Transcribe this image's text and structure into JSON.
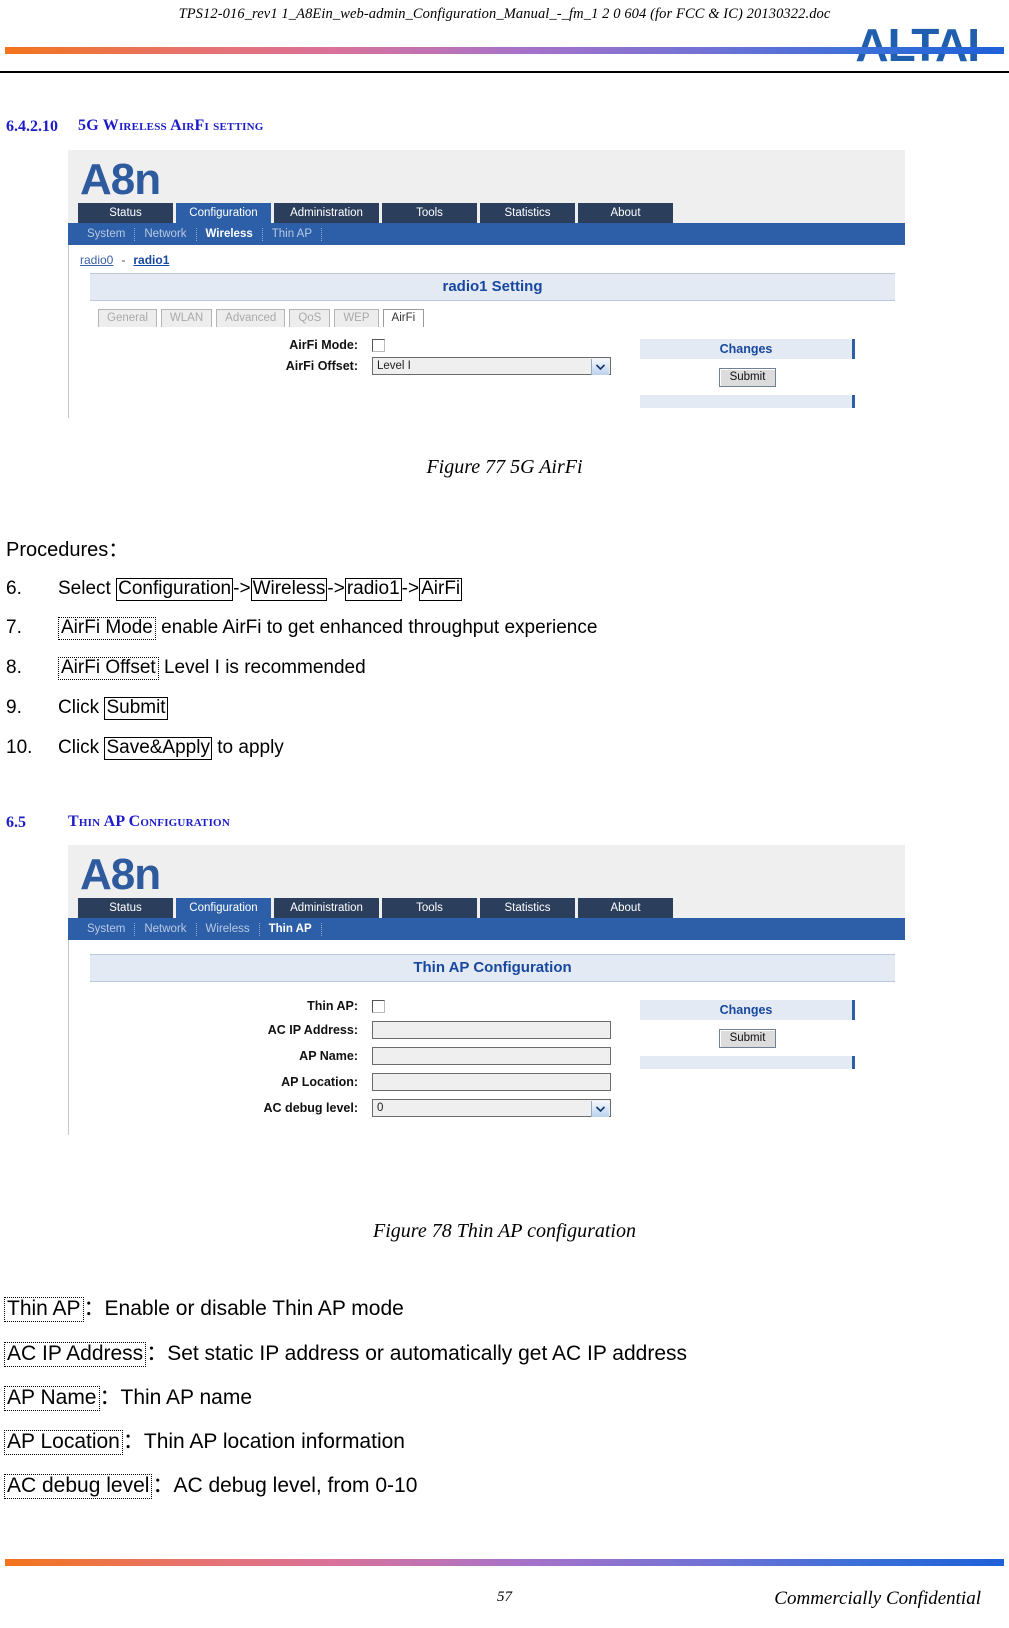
{
  "header": {
    "doc_title": "TPS12-016_rev1 1_A8Ein_web-admin_Configuration_Manual_-_fm_1 2 0 604 (for FCC & IC) 20130322.doc",
    "logo_text": "ALTAI",
    "gradient_colors": [
      "#F2741B",
      "#D9729B",
      "#7272D4",
      "#1F5FD8"
    ]
  },
  "sections": {
    "s1": {
      "number": "6.4.2.10",
      "title": "5G Wireless AirFi setting"
    },
    "s2": {
      "number": "6.5",
      "title": "Thin AP Configuration"
    }
  },
  "screenshot1": {
    "product_logo": "A8n",
    "nav_tabs": [
      {
        "label": "Status",
        "active": false
      },
      {
        "label": "Configuration",
        "active": true
      },
      {
        "label": "Administration",
        "active": false
      },
      {
        "label": "Tools",
        "active": false
      },
      {
        "label": "Statistics",
        "active": false
      },
      {
        "label": "About",
        "active": false
      }
    ],
    "sub_nav": [
      {
        "label": "System",
        "active": false
      },
      {
        "label": "Network",
        "active": false
      },
      {
        "label": "Wireless",
        "active": true
      },
      {
        "label": "Thin AP",
        "active": false
      }
    ],
    "radio_links": {
      "radio0": "radio0",
      "separator": "-",
      "radio1": "radio1"
    },
    "panel_title": "radio1 Setting",
    "sub_tabs": [
      {
        "label": "General",
        "active": false
      },
      {
        "label": "WLAN",
        "active": false
      },
      {
        "label": "Advanced",
        "active": false
      },
      {
        "label": "QoS",
        "active": false
      },
      {
        "label": "WEP",
        "active": false
      },
      {
        "label": "AirFi",
        "active": true
      }
    ],
    "fields": [
      {
        "label": "AirFi Mode:",
        "type": "checkbox",
        "value": ""
      },
      {
        "label": "AirFi Offset:",
        "type": "select",
        "value": "Level I"
      }
    ],
    "changes": {
      "title": "Changes",
      "submit_label": "Submit"
    }
  },
  "figure77": {
    "caption": "Figure 77 5G AirFi"
  },
  "procedures": {
    "heading": "Procedures：",
    "items": [
      {
        "num": "6.",
        "parts": [
          {
            "t": "Select ",
            "style": "plain"
          },
          {
            "t": "Configuration",
            "style": "box"
          },
          {
            "t": "->",
            "style": "plain"
          },
          {
            "t": "Wireless",
            "style": "box"
          },
          {
            "t": "->",
            "style": "plain"
          },
          {
            "t": "radio1",
            "style": "box"
          },
          {
            "t": "->",
            "style": "plain"
          },
          {
            "t": "AirFi",
            "style": "box"
          }
        ]
      },
      {
        "num": "7.",
        "parts": [
          {
            "t": "AirFi Mode",
            "style": "dotted"
          },
          {
            "t": " enable AirFi to get enhanced throughput experience",
            "style": "plain"
          }
        ]
      },
      {
        "num": "8.",
        "parts": [
          {
            "t": "AirFi Offset",
            "style": "dotted"
          },
          {
            "t": " Level I is recommended",
            "style": "plain"
          }
        ]
      },
      {
        "num": "9.",
        "parts": [
          {
            "t": "Click ",
            "style": "plain"
          },
          {
            "t": "Submit",
            "style": "box"
          }
        ]
      },
      {
        "num": "10.",
        "parts": [
          {
            "t": "Click ",
            "style": "plain"
          },
          {
            "t": "Save&Apply",
            "style": "box"
          },
          {
            "t": " to apply",
            "style": "plain"
          }
        ]
      }
    ]
  },
  "screenshot2": {
    "product_logo": "A8n",
    "nav_tabs": [
      {
        "label": "Status",
        "active": false
      },
      {
        "label": "Configuration",
        "active": true
      },
      {
        "label": "Administration",
        "active": false
      },
      {
        "label": "Tools",
        "active": false
      },
      {
        "label": "Statistics",
        "active": false
      },
      {
        "label": "About",
        "active": false
      }
    ],
    "sub_nav": [
      {
        "label": "System",
        "active": false
      },
      {
        "label": "Network",
        "active": false
      },
      {
        "label": "Wireless",
        "active": false
      },
      {
        "label": "Thin AP",
        "active": true
      }
    ],
    "panel_title": "Thin AP Configuration",
    "fields": [
      {
        "label": "Thin AP:",
        "type": "checkbox",
        "value": ""
      },
      {
        "label": "AC IP Address:",
        "type": "text",
        "value": ""
      },
      {
        "label": "AP Name:",
        "type": "text",
        "value": ""
      },
      {
        "label": "AP Location:",
        "type": "text",
        "value": ""
      },
      {
        "label": "AC debug level:",
        "type": "select",
        "value": "0"
      }
    ],
    "changes": {
      "title": "Changes",
      "submit_label": "Submit"
    }
  },
  "figure78": {
    "caption": "Figure 78 Thin AP configuration"
  },
  "definitions": [
    {
      "term": "Thin AP ",
      "sep": "：",
      "desc": "Enable or disable Thin AP mode"
    },
    {
      "term": "AC IP Address",
      "sep": "：",
      "desc": "  Set static IP address or automatically get AC IP address"
    },
    {
      "term": "AP Name",
      "sep": "：",
      "desc": "  Thin AP name"
    },
    {
      "term": "AP Location",
      "sep": "：",
      "desc": "Thin AP location information"
    },
    {
      "term": "AC debug level",
      "sep": "：",
      "desc": "AC debug level, from 0-10"
    }
  ],
  "footer": {
    "page_number": "57",
    "confidential": "Commercially Confidential"
  }
}
